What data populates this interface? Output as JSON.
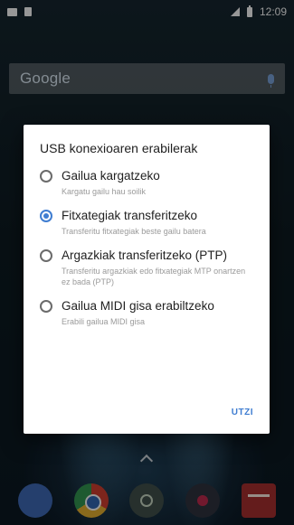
{
  "status_bar": {
    "time": "12:09",
    "left_icons": [
      "image-notification-icon",
      "sd-card-icon"
    ],
    "right_icons": [
      "signal-icon",
      "battery-icon"
    ]
  },
  "home": {
    "search_logo": "Google",
    "dock_apps": [
      "phone-app-icon",
      "chrome-app-icon",
      "camera-app-icon",
      "media-app-icon",
      "gmail-app-icon"
    ]
  },
  "dialog": {
    "title": "USB konexioaren erabilerak",
    "options": [
      {
        "label": "Gailua kargatzeko",
        "description": "Kargatu gailu hau soilik",
        "selected": false
      },
      {
        "label": "Fitxategiak transferitzeko",
        "description": "Transferitu fitxategiak beste gailu batera",
        "selected": true
      },
      {
        "label": "Argazkiak transferitzeko (PTP)",
        "description": "Transferitu argazkiak edo fitxategiak MTP onartzen ez bada (PTP)",
        "selected": false
      },
      {
        "label": "Gailua MIDI gisa erabiltzeko",
        "description": "Erabili gailua MIDI gisa",
        "selected": false
      }
    ],
    "cancel_label": "UTZI"
  },
  "colors": {
    "accent": "#3f7dd1",
    "dialog_bg": "#ffffff",
    "secondary_text": "#9a9a9a"
  }
}
